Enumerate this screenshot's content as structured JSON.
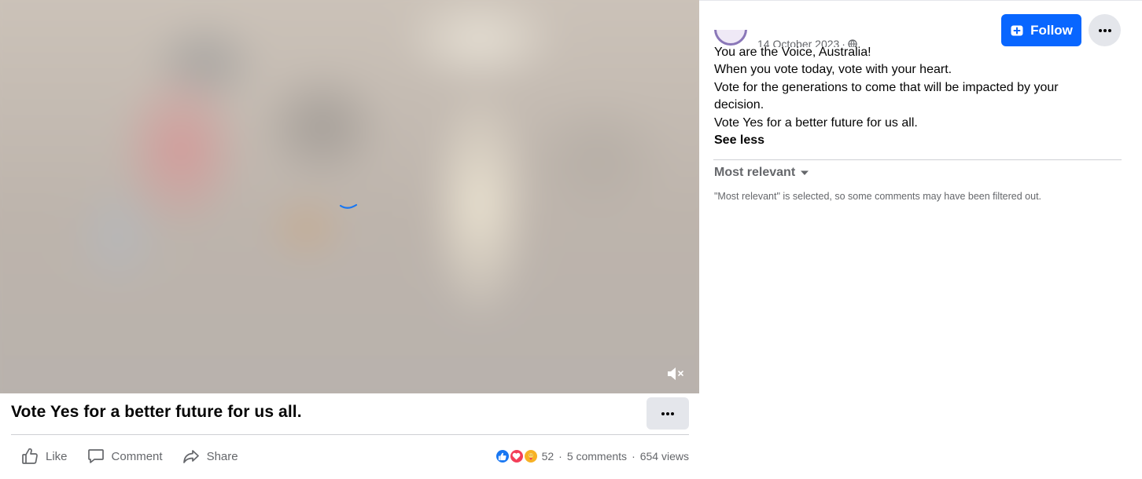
{
  "post": {
    "title": "Vote Yes for a better future for us all.",
    "date": "14 October 2023",
    "date_separator": "·",
    "body_lines": [
      "You are the Voice, Australia!",
      "When you vote today, vote with your heart.",
      "Vote for the generations to come that will be impacted by your",
      "decision.",
      "Vote Yes for a better future for us all."
    ],
    "see_less": "See less"
  },
  "header": {
    "follow_label": "Follow"
  },
  "actions": {
    "like": "Like",
    "comment": "Comment",
    "share": "Share"
  },
  "stats": {
    "reaction_count": "52",
    "comments": "5 comments",
    "views": "654 views",
    "separator": "·",
    "reaction_icons": [
      "like-reaction-icon",
      "love-reaction-icon",
      "care-reaction-icon"
    ]
  },
  "comments": {
    "sort_label": "Most relevant",
    "filter_note": "\"Most relevant\" is selected, so some comments may have been filtered out."
  },
  "colors": {
    "follow_button": "#0866ff",
    "text_secondary": "#65676b",
    "loading_spinner": "#1877f2"
  }
}
